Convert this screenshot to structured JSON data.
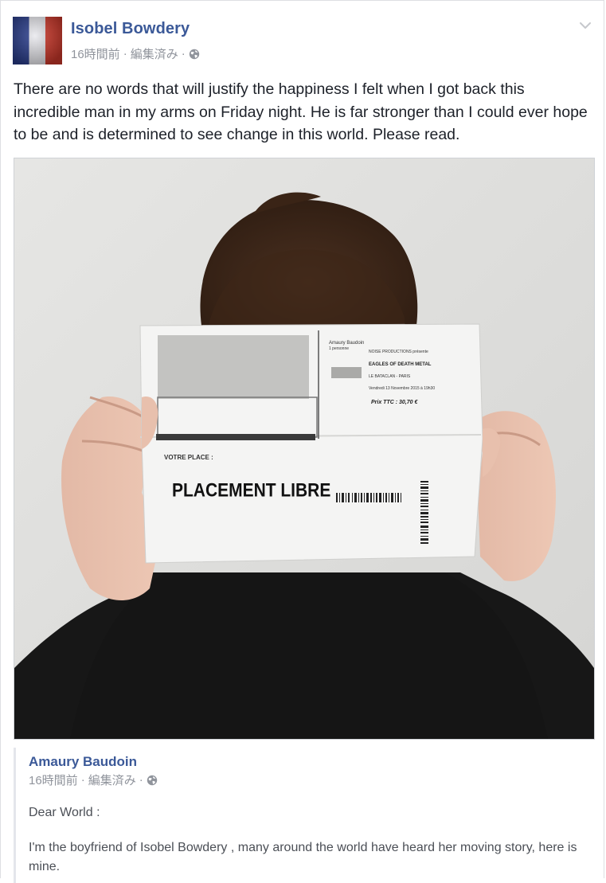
{
  "post": {
    "author": "Isobel Bowdery",
    "time": "16時間前",
    "separator": "·",
    "edited": "編集済み",
    "privacy_icon": "globe-icon",
    "menu_icon": "chevron-down-icon",
    "text": "There are no words that will justify the happiness I felt when I got back this incredible man in my arms on Friday night. He is far stronger than I could ever hope to be and is determined to see change in this world. Please read."
  },
  "photo": {
    "ticket": {
      "name_line": "Amaury Baudoin",
      "persons": "1 personne",
      "presenter": "NOISE PRODUCTIONS présente",
      "band": "EAGLES OF DEATH METAL",
      "venue": "LE BATACLAN - PARIS",
      "date": "Vendredi 13 Novembre 2015 à 19h30",
      "price": "Prix TTC : 30,70 €",
      "place_label": "VOTRE PLACE :",
      "placement": "PLACEMENT LIBRE"
    }
  },
  "shared": {
    "author": "Amaury Baudoin",
    "time": "16時間前",
    "separator": "·",
    "edited": "編集済み",
    "privacy_icon": "globe-icon",
    "greeting": "Dear World :",
    "body": "I'm the boyfriend of Isobel Bowdery , many around the world have heard her moving story, here is mine."
  }
}
